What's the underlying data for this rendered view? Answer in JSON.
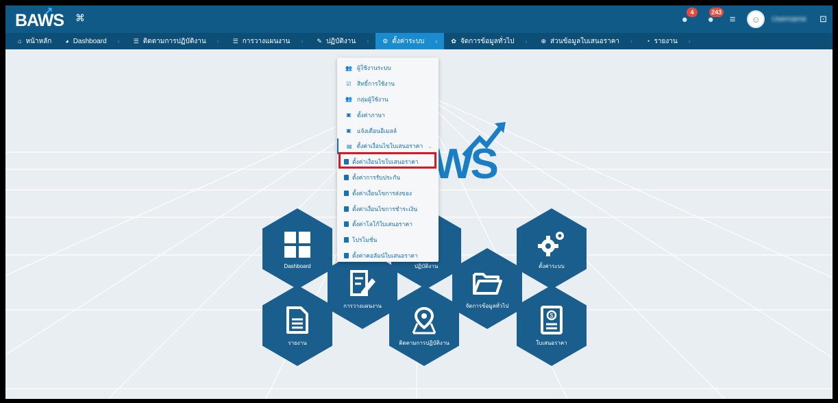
{
  "app": {
    "logo_text": "BAWS"
  },
  "top_right": {
    "badges": [
      {
        "icon": "bell-icon",
        "count": "4"
      },
      {
        "icon": "notification-icon",
        "count": "243"
      }
    ],
    "username": "Username"
  },
  "nav": {
    "items": [
      {
        "icon": "home-icon",
        "label": "หน้าหลัก"
      },
      {
        "icon": "dashboard-icon",
        "label": "Dashboard"
      },
      {
        "icon": "list-icon",
        "label": "ติดตามการปฏิบัติงาน"
      },
      {
        "icon": "list-icon",
        "label": "การวางแผนงาน"
      },
      {
        "icon": "edit-icon",
        "label": "ปฏิบัติงาน"
      },
      {
        "icon": "gears-icon",
        "label": "ตั้งค่าระบบ"
      },
      {
        "icon": "gear-icon",
        "label": "จัดการข้อมูลทั่วไป"
      },
      {
        "icon": "tag-icon",
        "label": "ส่วนข้อมูลใบเสนอราคา"
      },
      {
        "icon": "chart-icon",
        "label": "รายงาน"
      }
    ]
  },
  "dropdown": {
    "items": [
      {
        "icon": "users-icon",
        "label": "ผู้ใช้งานระบบ"
      },
      {
        "icon": "check-icon",
        "label": "สิทธิ์การใช้งาน"
      },
      {
        "icon": "group-icon",
        "label": "กลุ่มผู้ใช้งาน"
      },
      {
        "icon": "calendar-icon",
        "label": "ตั้งค่าภาษา"
      },
      {
        "icon": "calendar-icon",
        "label": "แจ้งเตือนอีเมลล์"
      },
      {
        "icon": "doc-icon",
        "label": "ตั้งค่าเงื่อนไขใบเสนอราคา"
      }
    ],
    "sub_items": [
      {
        "label": "ตั้งค่าเงื่อนไขใบเสนอราคา"
      },
      {
        "label": "ตั้งค่าการรับประกัน"
      },
      {
        "label": "ตั้งค่าเงื่อนไขการส่งของ"
      },
      {
        "label": "ตั้งค่าเงื่อนไขการชำระเงิน"
      },
      {
        "label": "ตั้งค่าโลโก้ใบเสนอราคา"
      },
      {
        "label": "โปรโมชั่น"
      },
      {
        "label": "ตั้งค่าคอลัมน์ใบเสนอราคา"
      }
    ]
  },
  "hexes": {
    "dashboard": "Dashboard",
    "planning": "การวางแผนงาน",
    "center_hidden": "ปฏิบัติงาน",
    "data_mgmt": "จัดการข้อมูลทั่วไป",
    "settings": "ตั้งค่าระบบ",
    "report": "รายงาน",
    "tracking": "ติดตามการปฏิบัติงาน",
    "quotation": "ใบเสนอราคา"
  },
  "center_logo": "WS",
  "colors": {
    "topbar": "#0f5a86",
    "navbar": "#0c4e76",
    "active": "#1b8bd0",
    "hex": "#1a5e8d",
    "highlight": "#e3141b"
  }
}
